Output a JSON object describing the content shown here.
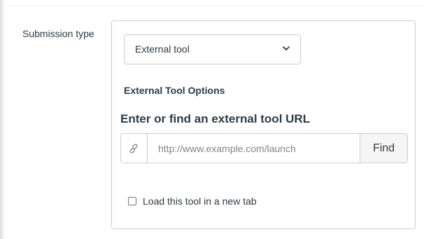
{
  "submission": {
    "label": "Submission type",
    "selected_option": "External tool",
    "options_heading": "External Tool Options",
    "url_label": "Enter or find an external tool URL",
    "url_placeholder": "http://www.example.com/launch",
    "find_label": "Find",
    "new_tab_label": "Load this tool in a new tab",
    "new_tab_checked": false
  },
  "icons": {
    "link": "link-icon",
    "select": "chevron-down-icon"
  },
  "colors": {
    "text": "#2d3b45",
    "border": "#c7cdd1",
    "find_button_bg": "#f5f5f5",
    "placeholder": "#7b878f"
  }
}
